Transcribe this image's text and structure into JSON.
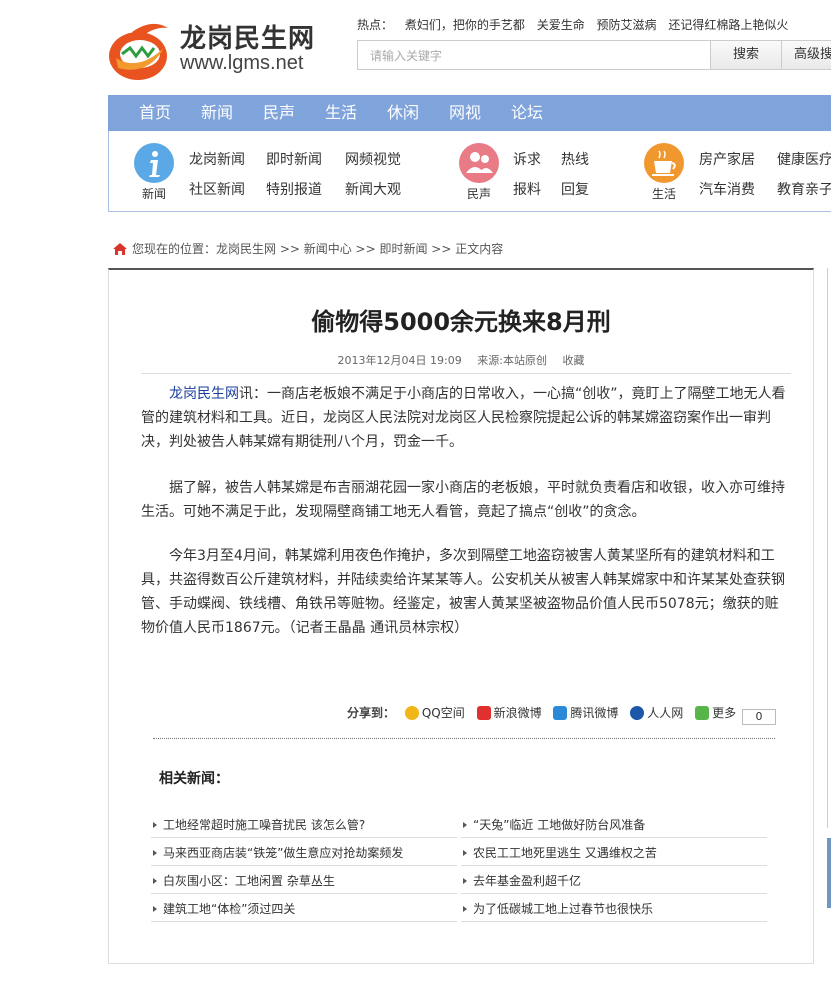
{
  "site": {
    "title": "龙岗民生网",
    "url": "www.lgms.net"
  },
  "hot": {
    "label": "热点：",
    "links": [
      "煮妇们，把你的手艺都",
      "关爱生命",
      "预防艾滋病",
      "还记得红棉路上艳似火"
    ]
  },
  "search": {
    "placeholder": "请输入关键字",
    "button": "搜索",
    "advanced": "高级搜"
  },
  "nav": [
    "首页",
    "新闻",
    "民声",
    "生活",
    "休闲",
    "网视",
    "论坛"
  ],
  "categories": [
    {
      "label": "新闻",
      "icon": "info-icon",
      "color": "#5aa9e6",
      "links": [
        "龙岗新闻",
        "即时新闻",
        "网频视觉",
        "社区新闻",
        "特别报道",
        "新闻大观"
      ]
    },
    {
      "label": "民声",
      "icon": "people-icon",
      "color": "#e87b86",
      "links": [
        "诉求",
        "热线",
        "报料",
        "回复"
      ]
    },
    {
      "label": "生活",
      "icon": "coffee-icon",
      "color": "#f0982e",
      "links": [
        "房产家居",
        "健康医疗",
        "汽车消费",
        "教育亲子"
      ]
    }
  ],
  "breadcrumb": "您现在的位置：龙岗民生网 >> 新闻中心 >> 即时新闻 >> 正文内容",
  "article": {
    "title": "偷物得5000余元换来8月刑",
    "date": "2013年12月04日 19:09",
    "source": "来源:本站原创",
    "favorite": "收藏",
    "source_link": "龙岗民生网",
    "p1_rest": "讯：一商店老板娘不满足于小商店的日常收入，一心搞“创收”，竟盯上了隔壁工地无人看管的建筑材料和工具。近日，龙岗区人民法院对龙岗区人民检察院提起公诉的韩某嫦盗窃案作出一审判决，判处被告人韩某嫦有期徒刑八个月，罚金一千。",
    "p2": "据了解，被告人韩某嫦是布吉丽湖花园一家小商店的老板娘，平时就负责看店和收银，收入亦可维持生活。可她不满足于此，发现隔壁商铺工地无人看管，竟起了搞点“创收”的贪念。",
    "p3": "今年3月至4月间，韩某嫦利用夜色作掩护，多次到隔壁工地盗窃被害人黄某坚所有的建筑材料和工具，共盗得数百公斤建筑材料，并陆续卖给许某某等人。公安机关从被害人韩某嫦家中和许某某处查获钢管、手动蝶阀、铁线槽、角铁吊等赃物。经鉴定，被害人黄某坚被盗物品价值人民币5078元；缴获的赃物价值人民币1867元。（记者王晶晶 通讯员林宗权）"
  },
  "share": {
    "label": "分享到：",
    "items": [
      {
        "name": "QQ空间",
        "color": "#f2b619"
      },
      {
        "name": "新浪微博",
        "color": "#e0312f"
      },
      {
        "name": "腾讯微博",
        "color": "#2a8ad8"
      },
      {
        "name": "人人网",
        "color": "#1d58a8"
      },
      {
        "name": "更多",
        "color": "#58b54a"
      }
    ],
    "count": "0"
  },
  "related": {
    "title": "相关新闻：",
    "items": [
      "工地经常超时施工噪音扰民 该怎么管?",
      "“天兔”临近 工地做好防台风准备",
      "马来西亚商店装“铁笼”做生意应对抢劫案频发",
      "农民工工地死里逃生 又遇维权之苦",
      "白灰围小区：工地闲置 杂草丛生",
      "去年基金盈利超千亿",
      "建筑工地“体检”须过四关",
      "为了低碳城工地上过春节也很快乐"
    ]
  }
}
